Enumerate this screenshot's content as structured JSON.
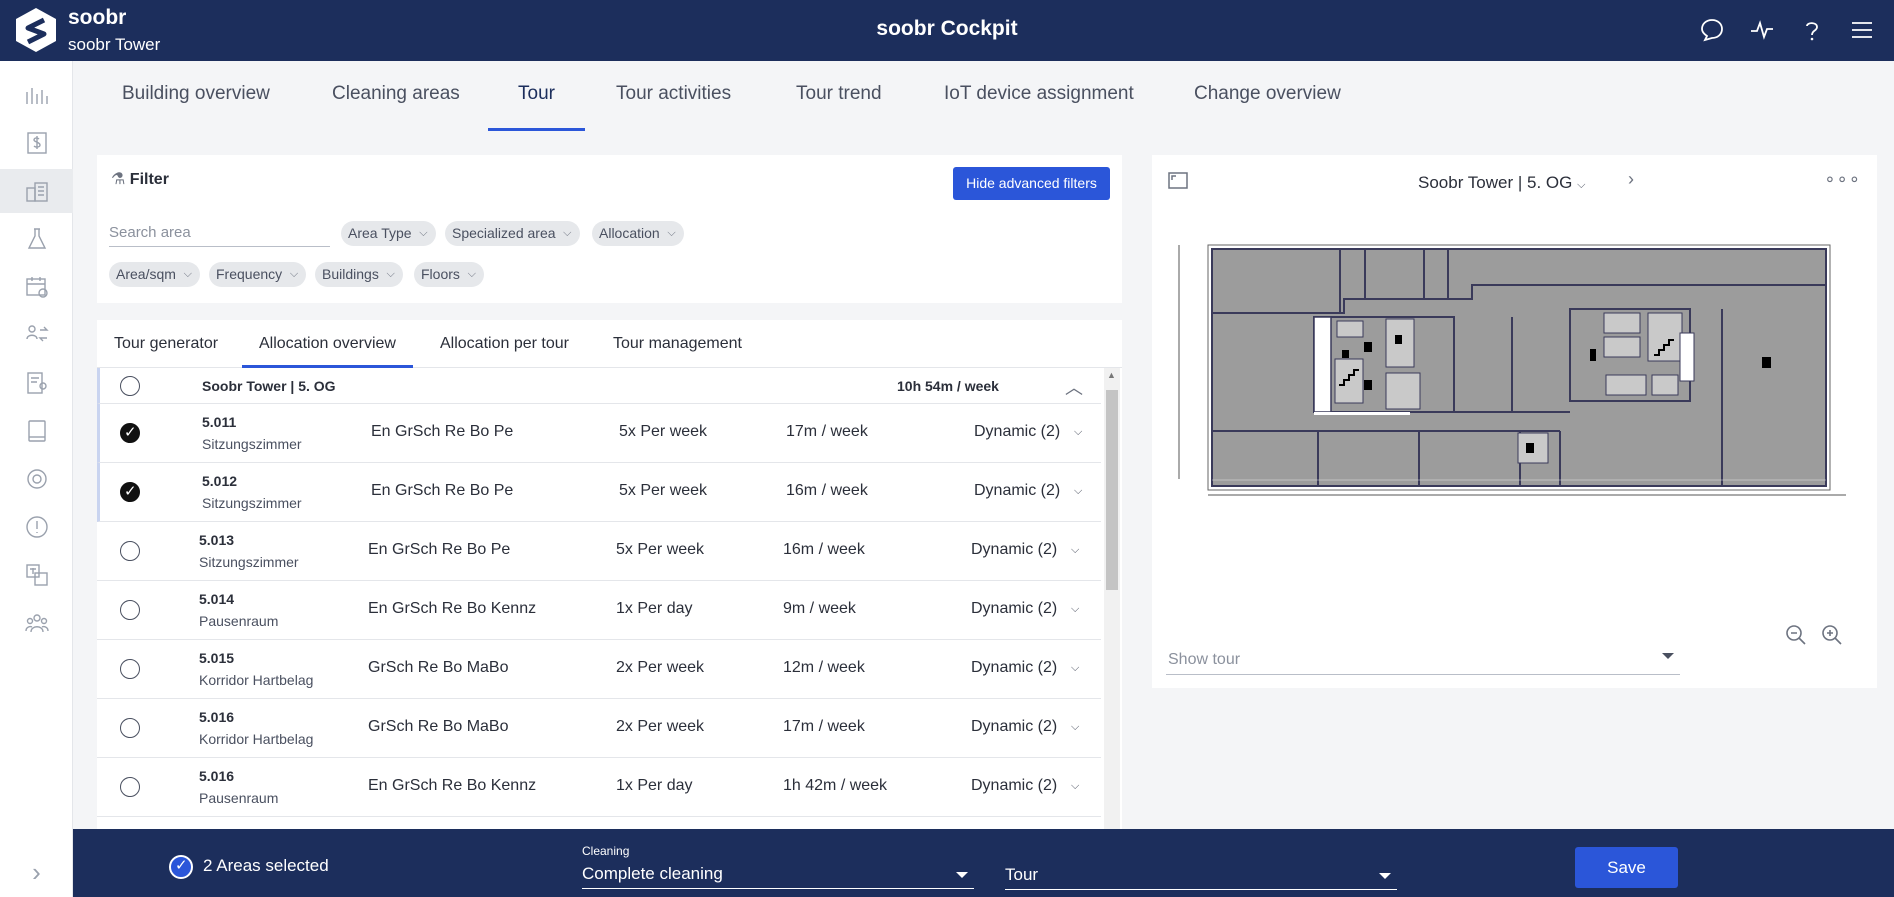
{
  "header": {
    "brand": "soobr",
    "building": "soobr Tower",
    "title": "soobr Cockpit"
  },
  "main_tabs": [
    "Building overview",
    "Cleaning areas",
    "Tour",
    "Tour activities",
    "Tour trend",
    "IoT device assignment",
    "Change overview"
  ],
  "filter": {
    "title": "Filter",
    "hide_button": "Hide advanced filters",
    "search_placeholder": "Search area",
    "chips": [
      "Area Type",
      "Specialized area",
      "Allocation",
      "Area/sqm",
      "Frequency",
      "Buildings",
      "Floors"
    ]
  },
  "sub_tabs": [
    "Tour generator",
    "Allocation overview",
    "Allocation per tour",
    "Tour management"
  ],
  "group": {
    "name": "Soobr Tower | 5. OG",
    "total": "10h 54m / week"
  },
  "rows": [
    {
      "code": "5.011",
      "type": "Sitzungszimmer",
      "tasks": "En GrSch Re Bo Pe",
      "frequency": "5x Per week",
      "time": "17m / week",
      "allocation": "Dynamic (2)",
      "selected": true
    },
    {
      "code": "5.012",
      "type": "Sitzungszimmer",
      "tasks": "En GrSch Re Bo Pe",
      "frequency": "5x Per week",
      "time": "16m / week",
      "allocation": "Dynamic (2)",
      "selected": true
    },
    {
      "code": "5.013",
      "type": "Sitzungszimmer",
      "tasks": "En GrSch Re Bo Pe",
      "frequency": "5x Per week",
      "time": "16m / week",
      "allocation": "Dynamic (2)",
      "selected": false
    },
    {
      "code": "5.014",
      "type": "Pausenraum",
      "tasks": "En GrSch Re Bo Kennz",
      "frequency": "1x Per day",
      "time": "9m / week",
      "allocation": "Dynamic (2)",
      "selected": false
    },
    {
      "code": "5.015",
      "type": "Korridor Hartbelag",
      "tasks": "GrSch Re Bo MaBo",
      "frequency": "2x Per week",
      "time": "12m / week",
      "allocation": "Dynamic (2)",
      "selected": false
    },
    {
      "code": "5.016",
      "type": "Korridor Hartbelag",
      "tasks": "GrSch Re Bo MaBo",
      "frequency": "2x Per week",
      "time": "17m / week",
      "allocation": "Dynamic (2)",
      "selected": false
    },
    {
      "code": "5.016",
      "type": "Pausenraum",
      "tasks": "En GrSch Re Bo Kennz",
      "frequency": "1x Per day",
      "time": "1h 42m / week",
      "allocation": "Dynamic (2)",
      "selected": false
    }
  ],
  "map": {
    "title": "Soobr Tower | 5. OG",
    "show_tour_placeholder": "Show tour"
  },
  "bottom": {
    "selected_text": "2 Areas selected",
    "cleaning_label": "Cleaning",
    "cleaning_value": "Complete cleaning",
    "tour_value": "Tour",
    "save": "Save"
  },
  "colors": {
    "navy": "#1c2e5c",
    "accent": "#2b56d9"
  }
}
